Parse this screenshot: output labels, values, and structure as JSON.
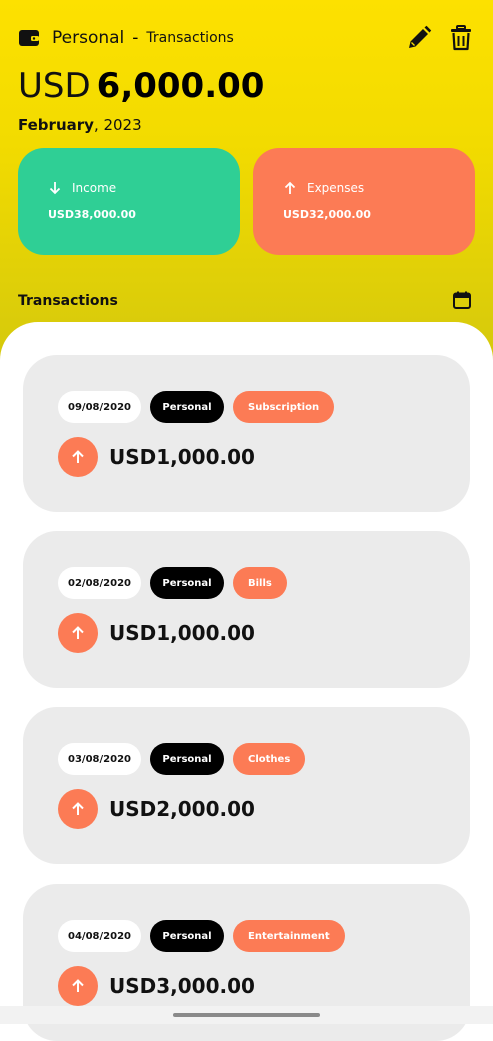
{
  "header": {
    "account_name": "Personal",
    "separator": "-",
    "page_title": "Transactions",
    "balance_currency": "USD",
    "balance_amount": "6,000.00",
    "month": "February",
    "year": ", 2023"
  },
  "summary": {
    "income_label": "Income",
    "income_amount": "USD38,000.00",
    "expenses_label": "Expenses",
    "expenses_amount": "USD32,000.00"
  },
  "section": {
    "title": "Transactions"
  },
  "colors": {
    "header_yellow": "#fde100",
    "income_green": "#2fcf95",
    "expense_orange": "#fc7b55"
  },
  "transactions": [
    {
      "date": "09/08/2020",
      "account": "Personal",
      "category": "Subscription",
      "amount": "USD1,000.00",
      "direction": "up-arrow-icon"
    },
    {
      "date": "02/08/2020",
      "account": "Personal",
      "category": "Bills",
      "amount": "USD1,000.00",
      "direction": "up-arrow-icon"
    },
    {
      "date": "03/08/2020",
      "account": "Personal",
      "category": "Clothes",
      "amount": "USD2,000.00",
      "direction": "up-arrow-icon"
    },
    {
      "date": "04/08/2020",
      "account": "Personal",
      "category": "Entertainment",
      "amount": "USD3,000.00",
      "direction": "up-arrow-icon"
    }
  ]
}
